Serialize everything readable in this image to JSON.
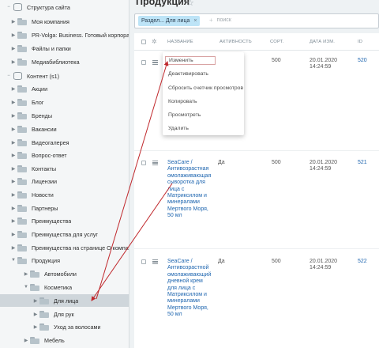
{
  "sidebar": {
    "items": [
      {
        "label": "Структура сайта",
        "toggle": "−",
        "icon": "database-icon"
      },
      {
        "label": "Моя компания",
        "toggle": "▶",
        "icon": "folder-icon"
      },
      {
        "label": "PR-Volga: Business. Готовый корпоративный са",
        "toggle": "▶",
        "icon": "folder-icon"
      },
      {
        "label": "Файлы и папки",
        "toggle": "▶",
        "icon": "folder-icon"
      },
      {
        "label": "Медиабиблиотека",
        "toggle": "▶",
        "icon": "folder-icon"
      },
      {
        "label": "Контент (s1)",
        "toggle": "−",
        "icon": "database-icon"
      },
      {
        "label": "Акции",
        "toggle": "▶",
        "icon": "folder-icon"
      },
      {
        "label": "Блог",
        "toggle": "▶",
        "icon": "folder-icon"
      },
      {
        "label": "Бренды",
        "toggle": "▶",
        "icon": "folder-icon"
      },
      {
        "label": "Вакансии",
        "toggle": "▶",
        "icon": "folder-icon"
      },
      {
        "label": "Видеогалерея",
        "toggle": "▶",
        "icon": "folder-icon"
      },
      {
        "label": "Вопрос-ответ",
        "toggle": "▶",
        "icon": "folder-icon"
      },
      {
        "label": "Контакты",
        "toggle": "▶",
        "icon": "folder-icon"
      },
      {
        "label": "Лицензии",
        "toggle": "▶",
        "icon": "folder-icon"
      },
      {
        "label": "Новости",
        "toggle": "▶",
        "icon": "folder-icon"
      },
      {
        "label": "Партнеры",
        "toggle": "▶",
        "icon": "folder-icon"
      },
      {
        "label": "Преимущества",
        "toggle": "▶",
        "icon": "folder-icon"
      },
      {
        "label": "Преимущества для услуг",
        "toggle": "▶",
        "icon": "folder-icon"
      },
      {
        "label": "Преимущества на странице О компании",
        "toggle": "▶",
        "icon": "folder-icon"
      },
      {
        "label": "Продукция",
        "toggle": "▼",
        "icon": "folder-icon"
      },
      {
        "label": "Автомобили",
        "toggle": "▶",
        "icon": "folder-icon"
      },
      {
        "label": "Косметика",
        "toggle": "▼",
        "icon": "folder-icon"
      },
      {
        "label": "Для лица",
        "toggle": "▶",
        "icon": "folder-icon"
      },
      {
        "label": "Для рук",
        "toggle": "▶",
        "icon": "folder-icon"
      },
      {
        "label": "Уход за волосами",
        "toggle": "▶",
        "icon": "folder-icon"
      },
      {
        "label": "Мебель",
        "toggle": "▶",
        "icon": "folder-icon"
      }
    ]
  },
  "page": {
    "title": "Продукция",
    "star_icon": "star-icon"
  },
  "filter": {
    "chip_label": "Раздел... Для лица",
    "chip_close": "×",
    "plus": "+",
    "search_placeholder": "поиск"
  },
  "table": {
    "headers": {
      "name": "НАЗВАНИЕ",
      "activity": "АКТИВНОСТЬ",
      "sort": "СОРТ.",
      "date": "ДАТА ИЗМ.",
      "id": "ID"
    },
    "rows": [
      {
        "name": "",
        "activity": "",
        "sort": "500",
        "date": "20.01.2020",
        "time": "14:24:59",
        "id": "520"
      },
      {
        "name_lines": [
          "SeaCare /",
          "Антивозрастная",
          "омолаживающая",
          "сыворотка для",
          "лица с",
          "Матриксилом и",
          "минералами",
          "Мертвого Моря,",
          "50 мл"
        ],
        "activity": "Да",
        "sort": "500",
        "date": "20.01.2020",
        "time": "14:24:59",
        "id": "521"
      },
      {
        "name_lines": [
          "SeaCare /",
          "Антивозрастной",
          "омолаживающий",
          "дневной крем",
          "для лица с",
          "Матриксилом и",
          "минералами",
          "Мертвого Моря,",
          "50 мл"
        ],
        "activity": "Да",
        "sort": "500",
        "date": "20.01.2020",
        "time": "14:24:59",
        "id": "522"
      }
    ]
  },
  "context_menu": {
    "items": [
      "Изменить",
      "Деактивировать",
      "Сбросить счетчик просмотров",
      "Копировать",
      "Просмотреть",
      "Удалить"
    ]
  },
  "colors": {
    "link": "#2067b0",
    "chip_bg": "#bde4f7",
    "annotation_arrow": "#c0282c"
  }
}
